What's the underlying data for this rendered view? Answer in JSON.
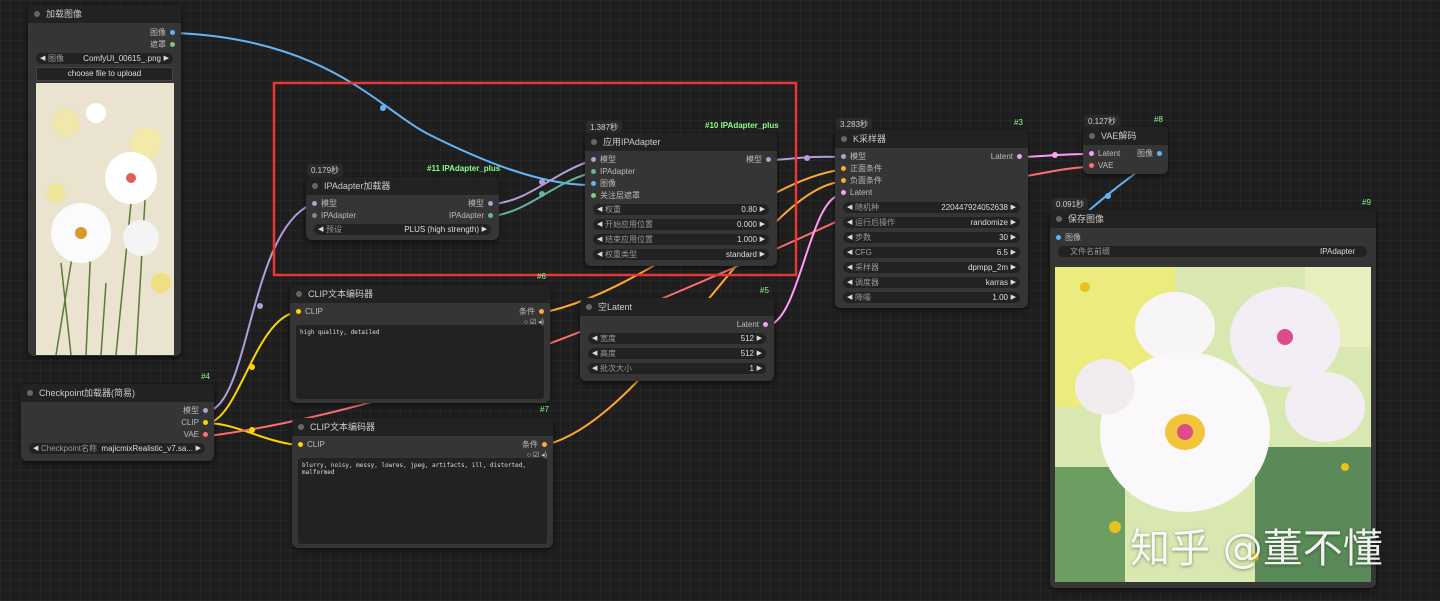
{
  "colors": {
    "model": "#b39ddb",
    "clip": "#ffd500",
    "vae": "#ff6e6e",
    "image": "#64b5f6",
    "latent": "#ff9cf9",
    "cond": "#ffa931",
    "mask": "#81c784",
    "ipadapter": "#66b3a0",
    "highlight": "#e53935"
  },
  "load_image": {
    "title": "加载图像",
    "out_image": "图像",
    "out_mask": "遮罩",
    "image_label": "图像",
    "image_value": "ComfyUI_00615_.png",
    "upload_label": "choose file to upload"
  },
  "checkpoint": {
    "title": "Checkpoint加载器(简易)",
    "id": "#4",
    "out_model": "模型",
    "out_clip": "CLIP",
    "out_vae": "VAE",
    "ckpt_label": "Checkpoint名称",
    "ckpt_value": "majicmixRealistic_v7.sa..."
  },
  "ipa_loader": {
    "title": "IPAdapter加载器",
    "time": "0.179秒",
    "tag": "#11 IPAdapter_plus",
    "in_model": "模型",
    "in_ipadapter": "IPAdapter",
    "out_model": "模型",
    "out_ipadapter": "IPAdapter",
    "preset_label": "预设",
    "preset_value": "PLUS (high strength)"
  },
  "ipa_apply": {
    "title": "应用IPAdapter",
    "time": "1.387秒",
    "tag": "#10 IPAdapter_plus",
    "in_model": "模型",
    "in_ipadapter": "IPAdapter",
    "in_image": "图像",
    "in_mask": "关注层遮罩",
    "out_model": "模型",
    "widgets": [
      {
        "label": "权重",
        "value": "0.80"
      },
      {
        "label": "开始应用位置",
        "value": "0.000"
      },
      {
        "label": "结束应用位置",
        "value": "1.000"
      },
      {
        "label": "权重类型",
        "value": "standard"
      }
    ]
  },
  "clip_pos": {
    "title": "CLIP文本编码器",
    "id": "#6",
    "in_clip": "CLIP",
    "out_cond": "条件",
    "text": "high quality, detailed"
  },
  "clip_neg": {
    "title": "CLIP文本编码器",
    "id": "#7",
    "in_clip": "CLIP",
    "out_cond": "条件",
    "text": "blurry, noisy, messy, lowres, jpeg, artifacts, ill, distorted, malformed"
  },
  "empty_latent": {
    "title": "空Latent",
    "id": "#5",
    "out_latent": "Latent",
    "widgets": [
      {
        "label": "宽度",
        "value": "512"
      },
      {
        "label": "高度",
        "value": "512"
      },
      {
        "label": "批次大小",
        "value": "1"
      }
    ]
  },
  "ksampler": {
    "title": "K采样器",
    "time": "3.283秒",
    "id": "#3",
    "in_model": "模型",
    "in_pos": "正面条件",
    "in_neg": "负面条件",
    "in_latent": "Latent",
    "out_latent": "Latent",
    "widgets": [
      {
        "label": "随机种",
        "value": "220447924052638"
      },
      {
        "label": "运行后操作",
        "value": "randomize"
      },
      {
        "label": "步数",
        "value": "30"
      },
      {
        "label": "CFG",
        "value": "6.5"
      },
      {
        "label": "采样器",
        "value": "dpmpp_2m"
      },
      {
        "label": "调度器",
        "value": "karras"
      },
      {
        "label": "降噪",
        "value": "1.00"
      }
    ]
  },
  "vae_decode": {
    "title": "VAE解码",
    "time": "0.127秒",
    "id": "#8",
    "in_latent": "Latent",
    "in_vae": "VAE",
    "out_image": "图像"
  },
  "save_image": {
    "title": "保存图像",
    "time": "0.091秒",
    "id": "#9",
    "in_image": "图像",
    "prefix_label": "文件名前缀",
    "prefix_value": "IPAdapter"
  },
  "watermark": "知乎 @董不懂"
}
